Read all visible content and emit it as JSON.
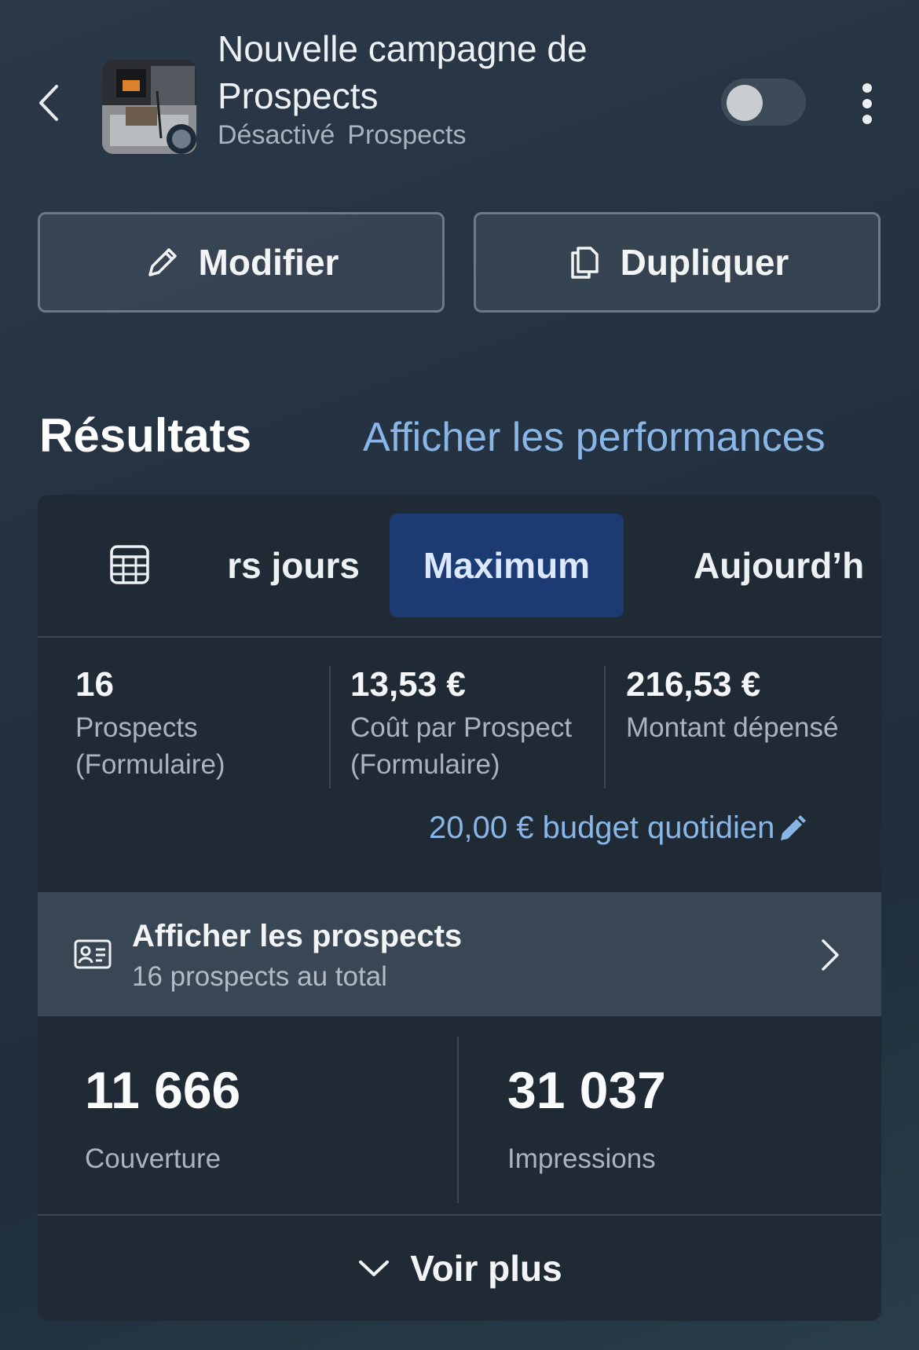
{
  "header": {
    "title": "Nouvelle campagne de Prospects",
    "status": "Désactivé",
    "objective": "Prospects",
    "toggle_on": false
  },
  "actions": {
    "edit_label": "Modifier",
    "duplicate_label": "Dupliquer"
  },
  "results": {
    "title": "Résultats",
    "performance_link": "Afficher les performances",
    "tabs": [
      {
        "label": "rs jours",
        "selected": false
      },
      {
        "label": "Maximum",
        "selected": true
      },
      {
        "label": "Aujourd’h",
        "selected": false
      }
    ],
    "metrics": [
      {
        "value": "16",
        "label": "Prospects (Formulaire)"
      },
      {
        "value": "13,53 €",
        "label": "Coût par Prospect (Formulaire)"
      },
      {
        "value": "216,53 €",
        "label": "Montant dépensé"
      }
    ],
    "budget": "20,00 € budget quotidien",
    "leads": {
      "title": "Afficher les prospects",
      "subtitle": "16 prospects au total"
    },
    "reach": {
      "value": "11 666",
      "label": "Couverture"
    },
    "impressions": {
      "value": "31 037",
      "label": "Impressions"
    },
    "see_more": "Voir plus"
  },
  "colors": {
    "accent_link": "#8ab6e6",
    "selected_tab_bg": "#1c3b72"
  }
}
